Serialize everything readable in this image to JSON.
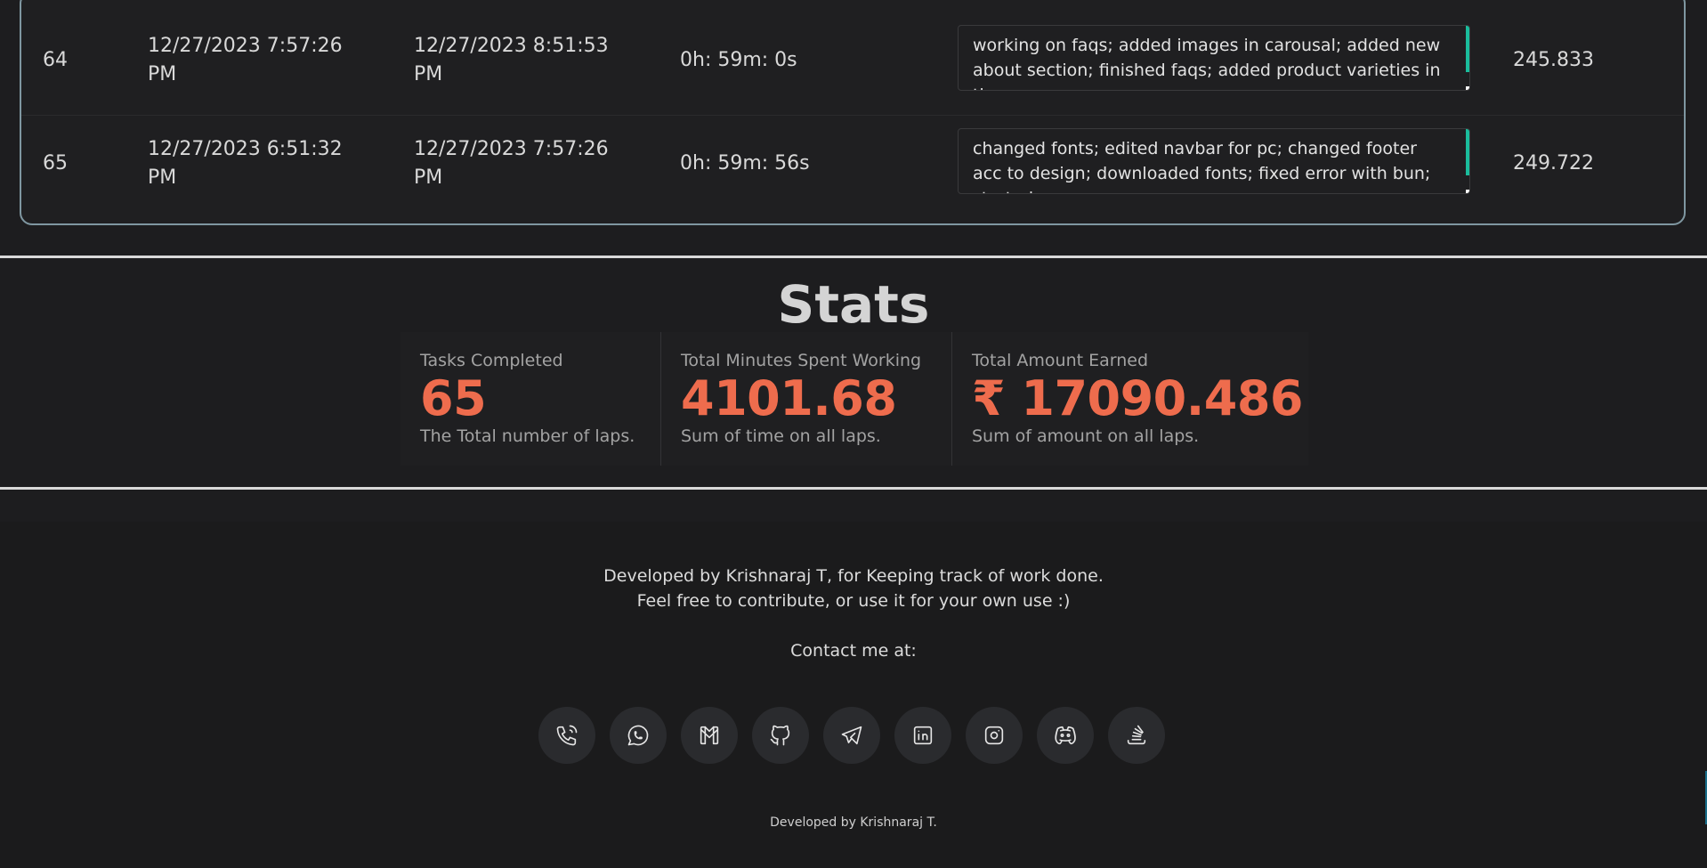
{
  "table": {
    "rows": [
      {
        "index": "64",
        "start": "12/27/2023 7:57:26 PM",
        "end": "12/27/2023 8:51:53 PM",
        "duration": "0h: 59m: 0s",
        "description": "working on faqs; added images in carousal; added new about section; finished faqs; added product varieties in the",
        "amount": "245.833"
      },
      {
        "index": "65",
        "start": "12/27/2023 6:51:32 PM",
        "end": "12/27/2023 7:57:26 PM",
        "duration": "0h: 59m: 56s",
        "description": "changed fonts; edited navbar for pc; changed footer acc to design; downloaded fonts; fixed error with bun; started",
        "amount": "249.722"
      }
    ]
  },
  "stats": {
    "title": "Stats",
    "items": [
      {
        "label": "Tasks Completed",
        "value": "65",
        "desc": "The Total number of laps."
      },
      {
        "label": "Total Minutes Spent Working",
        "value": "4101.68",
        "desc": "Sum of time on all laps."
      },
      {
        "label": "Total Amount Earned",
        "value": "₹ 17090.486",
        "desc": "Sum of amount on all laps."
      }
    ],
    "accent_color": "#ee6c4d"
  },
  "footer": {
    "line1": "Developed by Krishnaraj T, for Keeping track of work done.",
    "line2": "Feel free to contribute, or use it for your own use :)",
    "contact": "Contact me at:",
    "socials": [
      "phone-icon",
      "whatsapp-icon",
      "gmail-icon",
      "github-icon",
      "telegram-icon",
      "linkedin-icon",
      "instagram-icon",
      "discord-icon",
      "stackoverflow-icon"
    ],
    "credit": "Developed by Krishnaraj T."
  }
}
